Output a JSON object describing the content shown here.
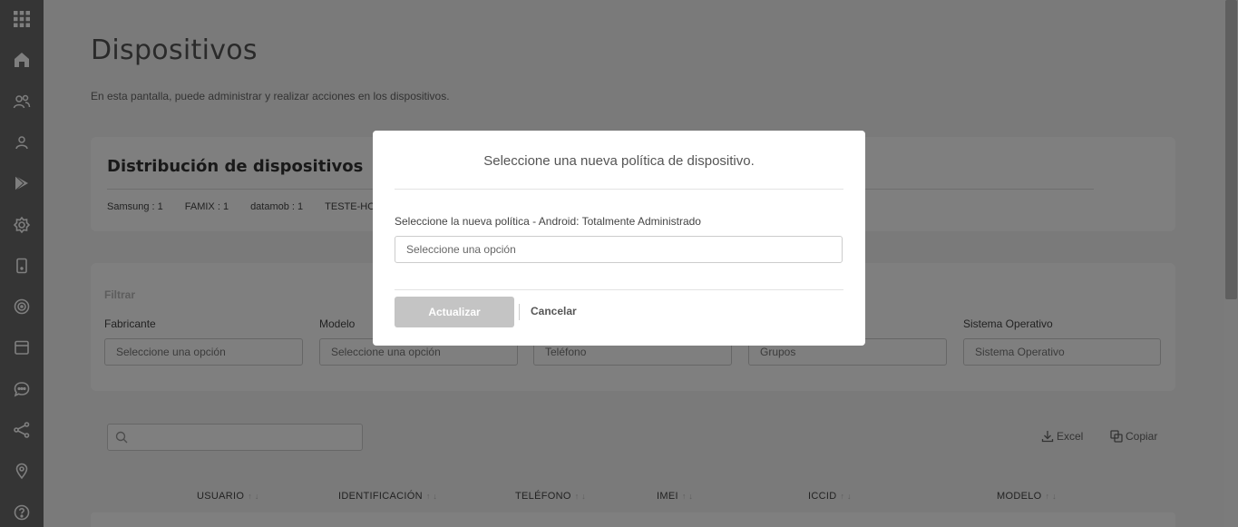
{
  "page": {
    "title": "Dispositivos",
    "subtitle": "En esta pantalla, puede administrar y realizar acciones en los dispositivos."
  },
  "distribution": {
    "title": "Distribución de dispositivos",
    "items": [
      "Samsung : 1",
      "FAMIX : 1",
      "datamob : 1",
      "TESTE-HORA"
    ]
  },
  "filters": {
    "title": "Filtrar",
    "fields": [
      {
        "label": "Fabricante",
        "placeholder": "Seleccione una opción"
      },
      {
        "label": "Modelo",
        "placeholder": "Seleccione una opción"
      },
      {
        "label": "",
        "placeholder": "Teléfono"
      },
      {
        "label": "",
        "placeholder": "Grupos"
      },
      {
        "label": "Sistema Operativo",
        "placeholder": "Sistema Operativo"
      }
    ]
  },
  "toolbar": {
    "excel_label": "Excel",
    "copy_label": "Copiar"
  },
  "table": {
    "columns": [
      "USUARIO",
      "IDENTIFICACIÓN",
      "TELÉFONO",
      "IMEI",
      "ICCID",
      "MODELO"
    ]
  },
  "modal": {
    "title": "Seleccione una nueva política de dispositivo.",
    "label": "Seleccione la nueva política - Android: Totalmente Administrado",
    "select_placeholder": "Seleccione una opción",
    "update_label": "Actualizar",
    "cancel_label": "Cancelar"
  },
  "sidebar": {
    "icons": [
      "apps-grid-icon",
      "home-icon",
      "users-icon",
      "user-icon",
      "play-store-icon",
      "settings-icon",
      "device-icon",
      "target-icon",
      "calendar-icon",
      "chat-icon",
      "share-icon",
      "location-pin-icon",
      "help-icon"
    ]
  },
  "colors": {
    "sidebar": "#6a6a6a",
    "overlay": "rgba(0,0,0,0.5)",
    "button_disabled": "#c4c4c4"
  }
}
